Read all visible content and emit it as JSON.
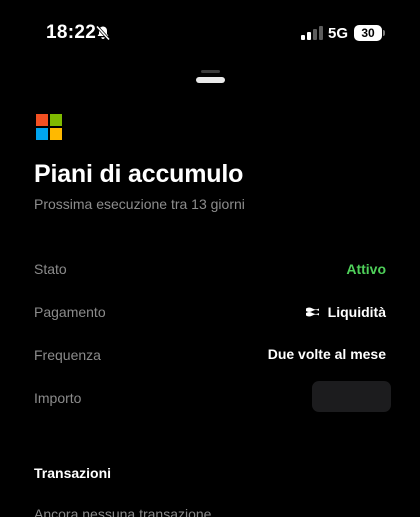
{
  "status_bar": {
    "time": "18:22",
    "network": "5G",
    "battery": "30"
  },
  "header": {
    "title": "Piani di accumulo",
    "subtitle": "Prossima esecuzione tra 13 giorni"
  },
  "details": [
    {
      "label": "Stato",
      "value": "Attivo",
      "value_color": "#4fd05a"
    },
    {
      "label": "Pagamento",
      "value": "Liquidità",
      "icon": "cash-icon"
    },
    {
      "label": "Frequenza",
      "value": "Due volte al mese"
    },
    {
      "label": "Importo",
      "value": ""
    }
  ],
  "transactions": {
    "title": "Transazioni",
    "empty_text": "Ancora nessuna transazione"
  }
}
